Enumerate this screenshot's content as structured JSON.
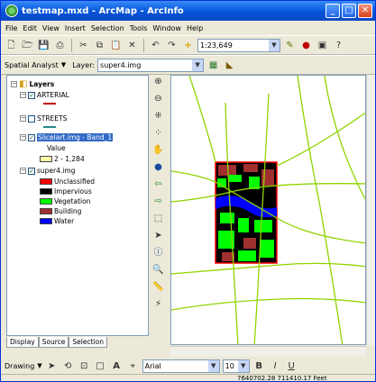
{
  "window": {
    "title": "testmap.mxd - ArcMap - ArcInfo"
  },
  "menubar": [
    "File",
    "Edit",
    "View",
    "Insert",
    "Selection",
    "Tools",
    "Window",
    "Help"
  ],
  "toolbar": {
    "scale": "1:23,649"
  },
  "spatial_analyst": {
    "label": "Spatial Analyst",
    "layer_label": "Layer:",
    "layer_value": "super4.img"
  },
  "toc": {
    "root": "Layers",
    "layers": [
      {
        "name": "ARTERIAL",
        "checked": true,
        "symbol_color": "#c00000"
      },
      {
        "name": "STREETS",
        "checked": false,
        "symbol_color": "#2a8a8a"
      },
      {
        "name": "Slicelart.img - Band_1",
        "checked": true,
        "value_label": "Value",
        "legend_label": "2 - 1,284",
        "legend_color": "#ffffa8"
      },
      {
        "name": "super4.img",
        "checked": true,
        "classes": [
          {
            "label": "Unclassified",
            "color": "#ff0000"
          },
          {
            "label": "Impervious",
            "color": "#000000"
          },
          {
            "label": "Vegetation",
            "color": "#00ff00"
          },
          {
            "label": "Building",
            "color": "#a03030"
          },
          {
            "label": "Water",
            "color": "#0000ff"
          }
        ]
      }
    ]
  },
  "tabs": [
    "Display",
    "Source",
    "Selection"
  ],
  "drawing": {
    "label": "Drawing",
    "font": "Arial",
    "font_size": "10",
    "bold": "B",
    "italic": "I",
    "underline": "U"
  },
  "status": {
    "coordinates": "7640702.28  711410.17 Feet"
  }
}
